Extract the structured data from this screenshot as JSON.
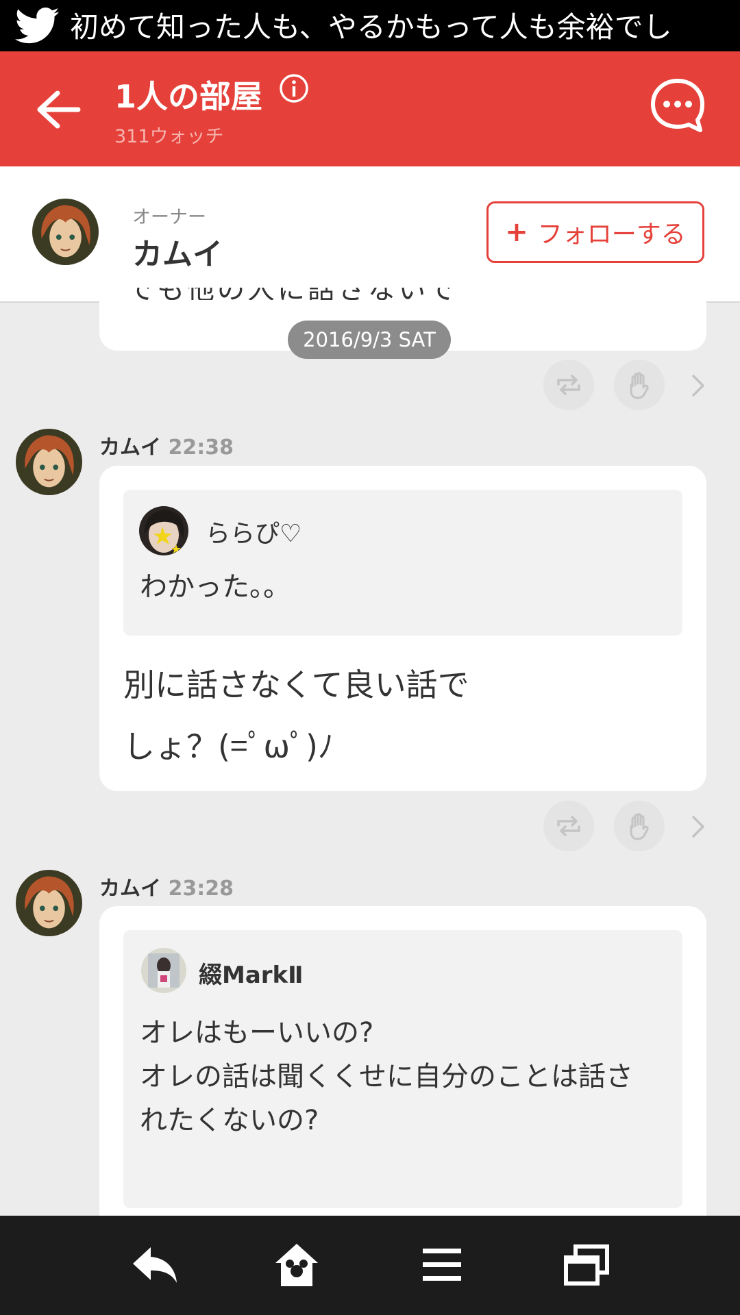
{
  "status_bar": {
    "notification_text": "初めて知った人も、やるかもって人も余裕でし",
    "icon": "twitter-bird-icon"
  },
  "header": {
    "title": "1人の部屋",
    "watch_count": "311ウォッチ",
    "back_icon": "arrow-left-icon",
    "info_icon": "info-icon",
    "chat_icon": "chat-bubble-icon",
    "color": "#e5413a"
  },
  "owner": {
    "label": "オーナー",
    "name": "カムイ",
    "follow_plus": "+",
    "follow_label": "フォローする"
  },
  "date_divider": "2016/9/3 SAT",
  "messages": [
    {
      "author": "カムイ",
      "time": "22:38",
      "quote": {
        "author": "ららぴ♡",
        "text": "わかった。。"
      },
      "reply_lines": [
        "別に話さなくて良い話で",
        "しょ？(=ﾟωﾟ)ﾉ"
      ]
    },
    {
      "author": "カムイ",
      "time": "23:28",
      "quote": {
        "author": "綴MarkⅡ",
        "lines": [
          "オレはもーいいの?",
          "オレの話は聞くくせに自分のことは話さ",
          "れたくないの?"
        ]
      }
    }
  ],
  "bottom_nav": {
    "items": [
      "back-arrow-icon",
      "home-icon",
      "menu-icon",
      "windows-icon"
    ]
  }
}
